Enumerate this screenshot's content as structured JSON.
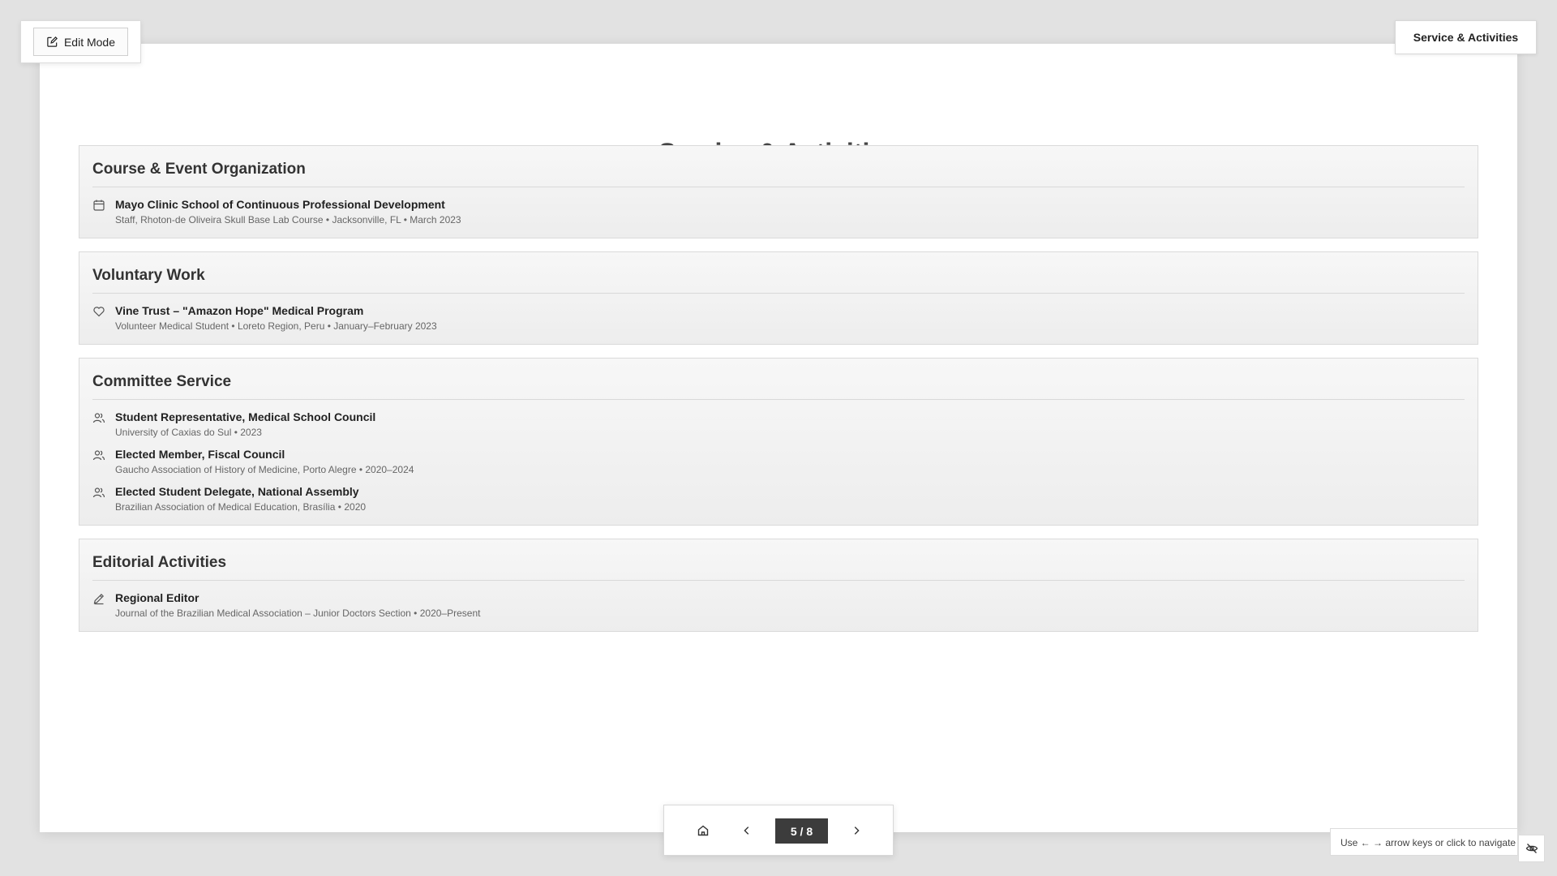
{
  "toolbar": {
    "edit_label": "Edit Mode"
  },
  "header": {
    "section_label": "Service & Activities"
  },
  "slide": {
    "title": "Service & Activities",
    "sections": [
      {
        "title": "Course & Event Organization",
        "entries": [
          {
            "icon": "calendar-icon",
            "title": "Mayo Clinic School of Continuous Professional Development",
            "sub": "Staff, Rhoton-de Oliveira Skull Base Lab Course • Jacksonville, FL • March 2023"
          }
        ]
      },
      {
        "title": "Voluntary Work",
        "entries": [
          {
            "icon": "heart-icon",
            "title": "Vine Trust – \"Amazon Hope\" Medical Program",
            "sub": "Volunteer Medical Student • Loreto Region, Peru • January–February 2023"
          }
        ]
      },
      {
        "title": "Committee Service",
        "entries": [
          {
            "icon": "users-icon",
            "title": "Student Representative, Medical School Council",
            "sub": "University of Caxias do Sul • 2023"
          },
          {
            "icon": "users-icon",
            "title": "Elected Member, Fiscal Council",
            "sub": "Gaucho Association of History of Medicine, Porto Alegre • 2020–2024"
          },
          {
            "icon": "users-icon",
            "title": "Elected Student Delegate, National Assembly",
            "sub": "Brazilian Association of Medical Education, Brasília • 2020"
          }
        ]
      },
      {
        "title": "Editorial Activities",
        "entries": [
          {
            "icon": "pen-icon",
            "title": "Regional Editor",
            "sub": "Journal of the Brazilian Medical Association – Junior Doctors Section • 2020–Present"
          }
        ]
      }
    ]
  },
  "nav": {
    "page_indicator": "5 / 8",
    "current_page": 5,
    "total_pages": 8
  },
  "hint": {
    "text": "Use ← → arrow keys or click to navigate"
  }
}
